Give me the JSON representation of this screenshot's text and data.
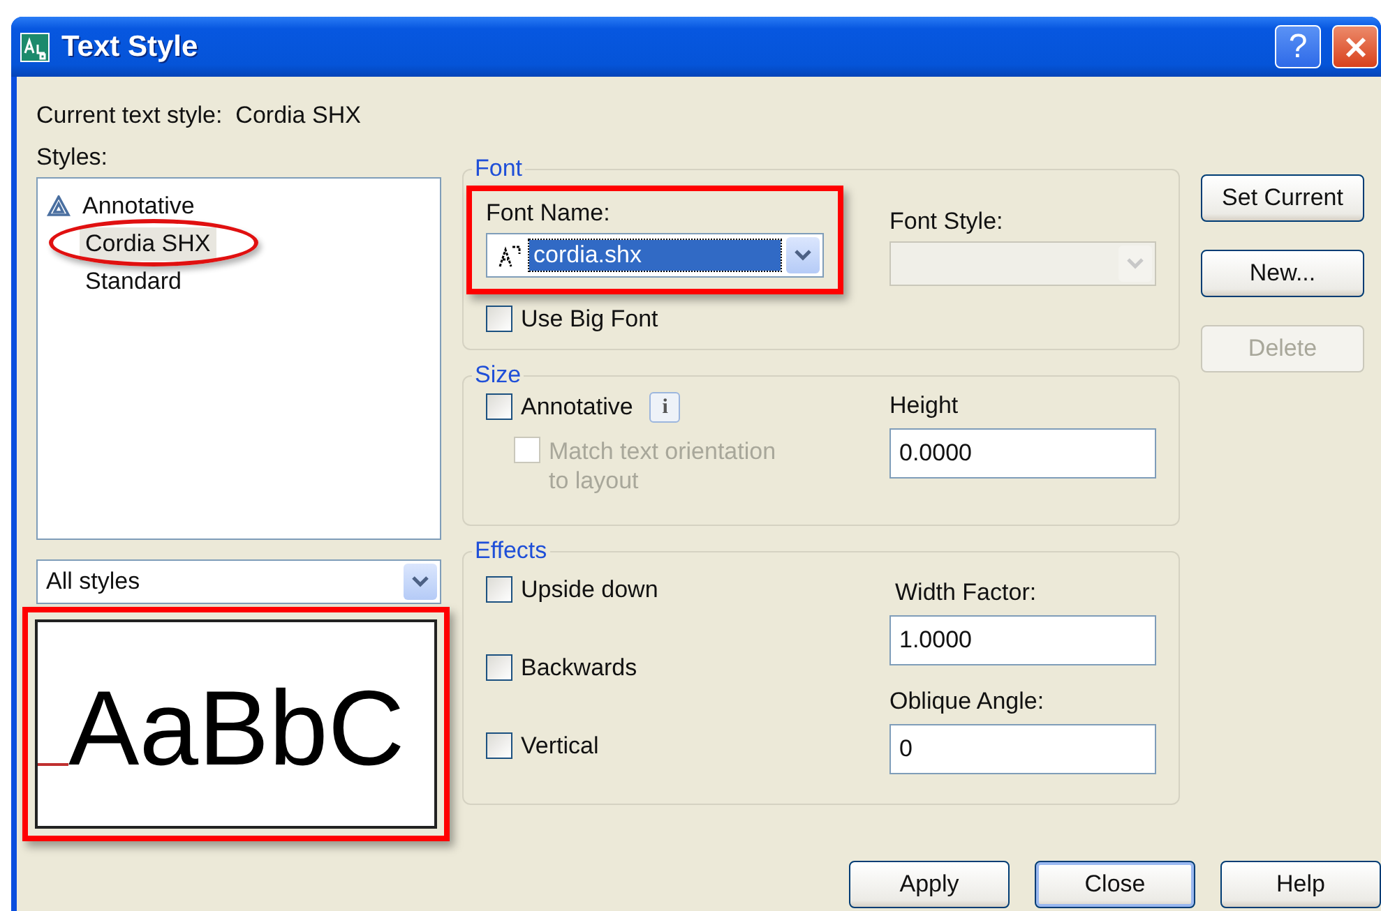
{
  "window": {
    "title": "Text Style",
    "help_glyph": "?"
  },
  "current_style": {
    "label": "Current text style:",
    "value": "Cordia SHX"
  },
  "styles": {
    "label": "Styles:",
    "items": [
      {
        "name": "Annotative",
        "annotative": true,
        "selected": false,
        "circled": false
      },
      {
        "name": "Cordia SHX",
        "annotative": false,
        "selected": true,
        "circled": true
      },
      {
        "name": "Standard",
        "annotative": false,
        "selected": false,
        "circled": false
      }
    ]
  },
  "filter": {
    "value": "All styles"
  },
  "preview": {
    "text": "AaBbC",
    "highlighted": true
  },
  "font": {
    "legend": "Font",
    "font_name": {
      "label": "Font Name:",
      "value": "cordia.shx",
      "highlighted": true
    },
    "font_style": {
      "label": "Font Style:",
      "disabled": true
    },
    "big_font": {
      "label": "Use Big Font",
      "checked": false
    }
  },
  "size": {
    "legend": "Size",
    "annotative": {
      "label": "Annotative",
      "checked": false,
      "info_glyph": "i"
    },
    "match": {
      "label": "Match text orientation to layout",
      "checked": false,
      "disabled": true
    },
    "height": {
      "label": "Height",
      "value": "0.0000"
    }
  },
  "effects": {
    "legend": "Effects",
    "checks": [
      {
        "label": "Upside down",
        "checked": false
      },
      {
        "label": "Backwards",
        "checked": false
      },
      {
        "label": "Vertical",
        "checked": false
      }
    ],
    "width_factor": {
      "label": "Width Factor:",
      "value": "1.0000"
    },
    "oblique_angle": {
      "label": "Oblique Angle:",
      "value": "0"
    }
  },
  "side_buttons": [
    {
      "label": "Set Current",
      "disabled": false
    },
    {
      "label": "New...",
      "disabled": false
    },
    {
      "label": "Delete",
      "disabled": true
    }
  ],
  "bottom_buttons": [
    {
      "label": "Apply",
      "default": false
    },
    {
      "label": "Close",
      "default": true
    },
    {
      "label": "Help",
      "default": false
    }
  ]
}
